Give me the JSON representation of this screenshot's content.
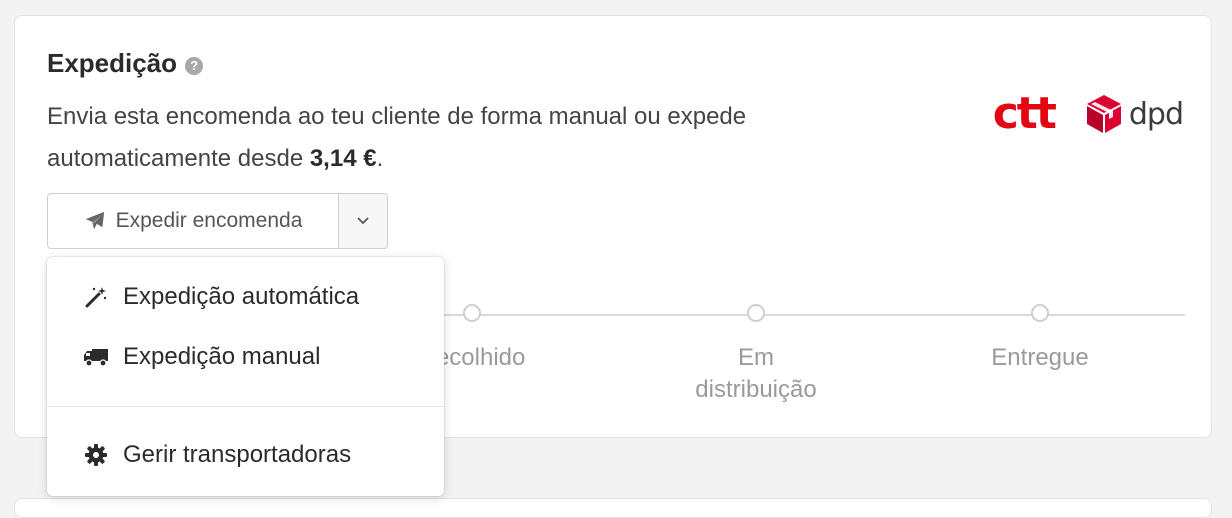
{
  "shipping": {
    "title": "Expedição",
    "description_pre": "Envia esta encomenda ao teu cliente de forma manual ou expede automaticamente desde ",
    "price": "3,14 €",
    "description_post": ".",
    "help_icon": "question-circle-icon",
    "carriers": [
      {
        "name": "ctt",
        "color": "#e30613"
      },
      {
        "name": "dpd",
        "color": "#dc0032"
      }
    ]
  },
  "split_button": {
    "label": "Expedir encomenda",
    "icon": "paper-plane-icon",
    "caret_icon": "chevron-down-icon"
  },
  "dropdown": {
    "items": [
      {
        "label": "Expedição automática",
        "icon": "magic-wand-icon"
      },
      {
        "label": "Expedição manual",
        "icon": "truck-icon"
      },
      {
        "label": "Gerir transportadoras",
        "icon": "gear-icon"
      }
    ]
  },
  "timeline": {
    "steps": [
      {
        "label": "Recolhido",
        "visible_text": "colhido"
      },
      {
        "label": "Em distribuição"
      },
      {
        "label": "Entregue"
      }
    ]
  },
  "colors": {
    "text_primary": "#2b2b2b",
    "text_muted": "#9a9a9a",
    "ctt_red": "#e30613",
    "dpd_red": "#dc0032"
  }
}
